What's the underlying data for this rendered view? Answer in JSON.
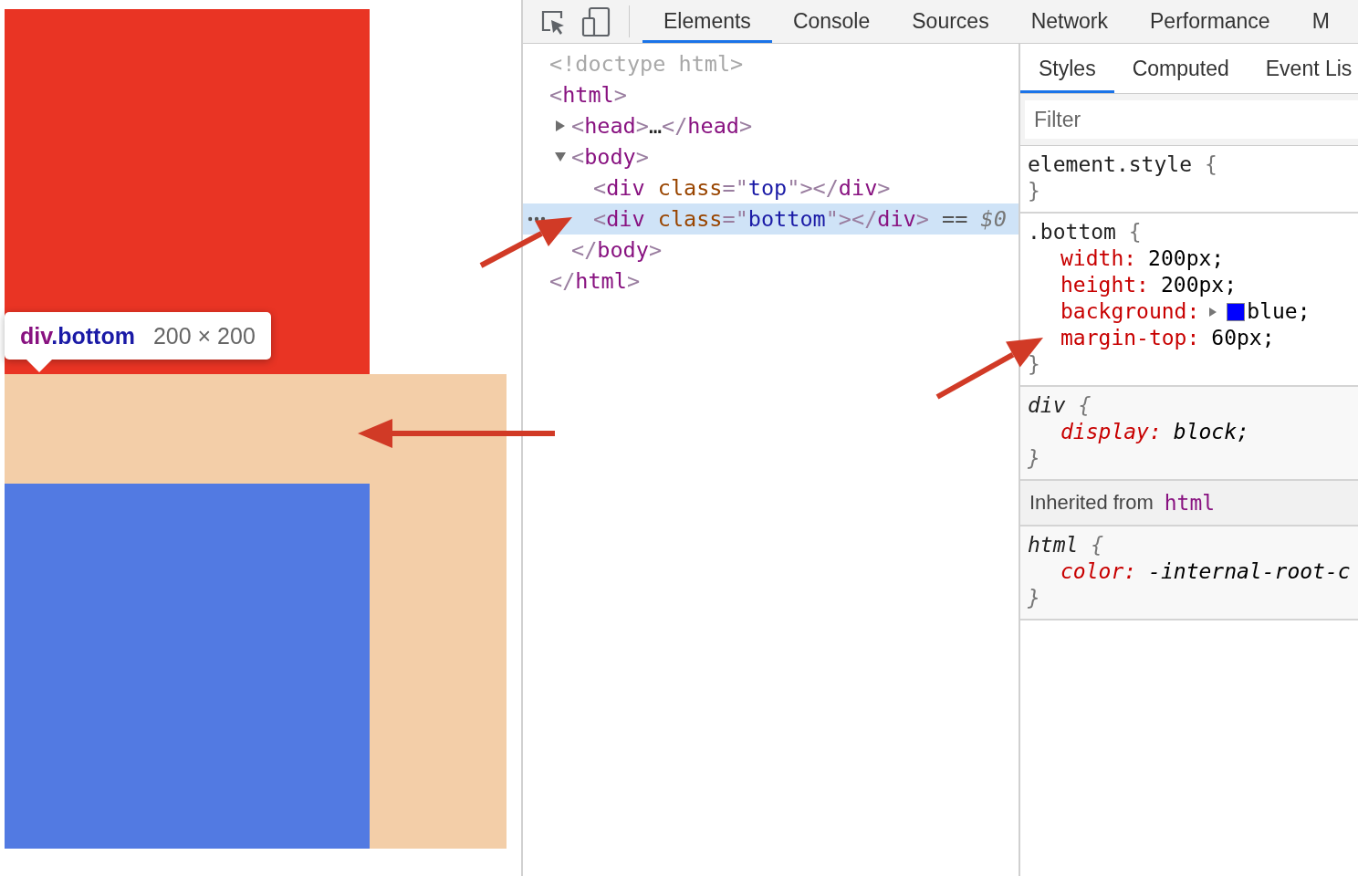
{
  "preview": {
    "tooltip": {
      "tag_name": "div",
      "class_name": ".bottom",
      "size": "200 × 200"
    }
  },
  "devtools": {
    "tabs": [
      {
        "label": "Elements",
        "selected": true
      },
      {
        "label": "Console",
        "selected": false
      },
      {
        "label": "Sources",
        "selected": false
      },
      {
        "label": "Network",
        "selected": false
      },
      {
        "label": "Performance",
        "selected": false
      },
      {
        "label": "M",
        "selected": false
      }
    ],
    "dom_tree": [
      {
        "tokens": [
          {
            "kind": "doctype",
            "text": "<!doctype html>"
          }
        ]
      },
      {
        "tokens": [
          {
            "kind": "punct",
            "text": "<"
          },
          {
            "kind": "tag",
            "text": "html"
          },
          {
            "kind": "punct",
            "text": ">"
          }
        ],
        "close": [
          {
            "kind": "punct",
            "text": "</"
          },
          {
            "kind": "tag",
            "text": "html"
          },
          {
            "kind": "punct",
            "text": ">"
          }
        ],
        "children": [
          {
            "expanded": false,
            "selected": false,
            "tokens": [
              {
                "kind": "punct",
                "text": "<"
              },
              {
                "kind": "tag",
                "text": "head"
              },
              {
                "kind": "punct",
                "text": ">"
              },
              {
                "kind": "ellipsis",
                "text": "…"
              },
              {
                "kind": "punct",
                "text": "</"
              },
              {
                "kind": "tag",
                "text": "head"
              },
              {
                "kind": "punct",
                "text": ">"
              }
            ]
          },
          {
            "expanded": true,
            "selected": false,
            "tokens": [
              {
                "kind": "punct",
                "text": "<"
              },
              {
                "kind": "tag",
                "text": "body"
              },
              {
                "kind": "punct",
                "text": ">"
              }
            ],
            "close": [
              {
                "kind": "punct",
                "text": "</"
              },
              {
                "kind": "tag",
                "text": "body"
              },
              {
                "kind": "punct",
                "text": ">"
              }
            ],
            "children": [
              {
                "selected": false,
                "tokens": [
                  {
                    "kind": "punct",
                    "text": "<"
                  },
                  {
                    "kind": "tag",
                    "text": "div"
                  },
                  {
                    "kind": "attr",
                    "text": " class"
                  },
                  {
                    "kind": "punct",
                    "text": "=\""
                  },
                  {
                    "kind": "value",
                    "text": "top"
                  },
                  {
                    "kind": "punct",
                    "text": "\">"
                  },
                  {
                    "kind": "punct",
                    "text": "</"
                  },
                  {
                    "kind": "tag",
                    "text": "div"
                  },
                  {
                    "kind": "punct",
                    "text": ">"
                  }
                ]
              },
              {
                "selected": true,
                "tokens": [
                  {
                    "kind": "punct",
                    "text": "<"
                  },
                  {
                    "kind": "tag",
                    "text": "div"
                  },
                  {
                    "kind": "attr",
                    "text": " class"
                  },
                  {
                    "kind": "punct",
                    "text": "=\""
                  },
                  {
                    "kind": "value",
                    "text": "bottom"
                  },
                  {
                    "kind": "punct",
                    "text": "\">"
                  },
                  {
                    "kind": "punct",
                    "text": "</"
                  },
                  {
                    "kind": "tag",
                    "text": "div"
                  },
                  {
                    "kind": "punct",
                    "text": ">"
                  },
                  {
                    "kind": "marker",
                    "text": " == "
                  },
                  {
                    "kind": "var",
                    "text": "$0"
                  }
                ]
              }
            ]
          }
        ]
      }
    ],
    "styles_tabs": [
      {
        "label": "Styles",
        "selected": true
      },
      {
        "label": "Computed",
        "selected": false
      },
      {
        "label": "Event Lis",
        "selected": false
      }
    ],
    "filter": {
      "placeholder": "Filter"
    },
    "sections": [
      {
        "kind": "rule",
        "user_agent": false,
        "selector": "element.style",
        "open": "{",
        "close": "}"
      },
      {
        "kind": "rule",
        "user_agent": false,
        "selector": ".bottom",
        "open": "{",
        "close": "}",
        "declarations": [
          {
            "property": "width:",
            "value": "200px;"
          },
          {
            "property": "height:",
            "value": "200px;"
          },
          {
            "property": "background:",
            "value": "blue;",
            "expandable": true,
            "color": "#0000ff"
          },
          {
            "property": "margin-top:",
            "value": "60px;"
          }
        ]
      },
      {
        "kind": "rule",
        "user_agent": true,
        "selector": "div",
        "open": "{",
        "close": "}",
        "declarations": [
          {
            "property": "display:",
            "value": "block;"
          }
        ]
      },
      {
        "kind": "inherited",
        "label": "Inherited from",
        "source": "html"
      },
      {
        "kind": "rule",
        "user_agent": true,
        "selector": "html",
        "open": "{",
        "close": "}",
        "declarations": [
          {
            "property": "color:",
            "value": "-internal-root-c"
          }
        ]
      }
    ]
  }
}
